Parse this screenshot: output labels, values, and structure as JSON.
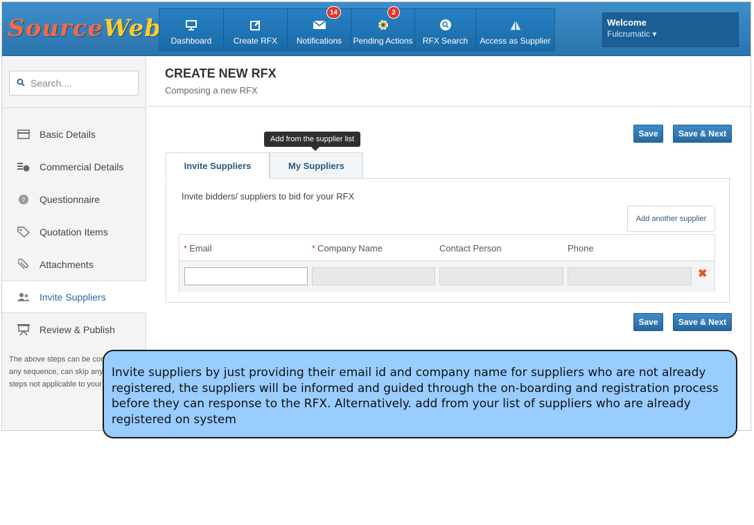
{
  "logo": {
    "part1": "Source",
    "part2": "Web"
  },
  "nav": [
    {
      "label": "Dashboard",
      "icon": "monitor-icon",
      "badge": ""
    },
    {
      "label": "Create RFX",
      "icon": "edit-icon",
      "badge": ""
    },
    {
      "label": "Notifications",
      "icon": "envelope-icon",
      "badge": "14"
    },
    {
      "label": "Pending Actions",
      "icon": "gear-icon",
      "badge": "2"
    },
    {
      "label": "RFX Search",
      "icon": "search-icon",
      "badge": ""
    },
    {
      "label": "Access as Supplier",
      "icon": "tent-icon",
      "badge": ""
    }
  ],
  "user": {
    "welcome": "Welcome",
    "name": "Fulcrumatic"
  },
  "sidebar": {
    "search_placeholder": "Search....",
    "steps": [
      {
        "label": "Basic Details",
        "icon": "card-icon"
      },
      {
        "label": "Commercial Details",
        "icon": "coins-icon"
      },
      {
        "label": "Questionnaire",
        "icon": "question-icon"
      },
      {
        "label": "Quotation Items",
        "icon": "tag-icon"
      },
      {
        "label": "Attachments",
        "icon": "paperclip-icon"
      },
      {
        "label": "Invite Suppliers",
        "icon": "users-icon"
      },
      {
        "label": "Review & Publish",
        "icon": "presentation-icon"
      }
    ],
    "active_step": "Invite Suppliers",
    "note": "The above steps can be completed in any sequence, can skip any of the steps not applicable to your RFX"
  },
  "page": {
    "title": "CREATE NEW RFX",
    "subtitle": "Composing a new RFX"
  },
  "actions": {
    "save": "Save",
    "save_next": "Save & Next"
  },
  "tooltip": "Add from the supplier list",
  "tabs": [
    {
      "label": "Invite Suppliers",
      "active": true
    },
    {
      "label": "My Suppliers",
      "active": false
    }
  ],
  "invite": {
    "intro": "Invite bidders/ suppliers to bid for your RFX",
    "add_another": "Add another supplier",
    "columns": [
      {
        "label": "Email",
        "required": true
      },
      {
        "label": "Company Name",
        "required": true
      },
      {
        "label": "Contact Person",
        "required": false
      },
      {
        "label": "Phone",
        "required": false
      }
    ],
    "row": {
      "email": "",
      "company": "",
      "contact": "",
      "phone": ""
    }
  },
  "callout": "Invite suppliers by just providing their email id and company name for suppliers who are not already registered, the suppliers will be informed and guided through the on-boarding and registration process before they can response to the RFX. Alternatively. add from your list of suppliers who are already registered on system",
  "colors": {
    "brand_blue": "#2a74ad",
    "nav_blue": "#1c6aa8",
    "callout_bg": "#99ccff",
    "badge_red": "#e0352b"
  }
}
